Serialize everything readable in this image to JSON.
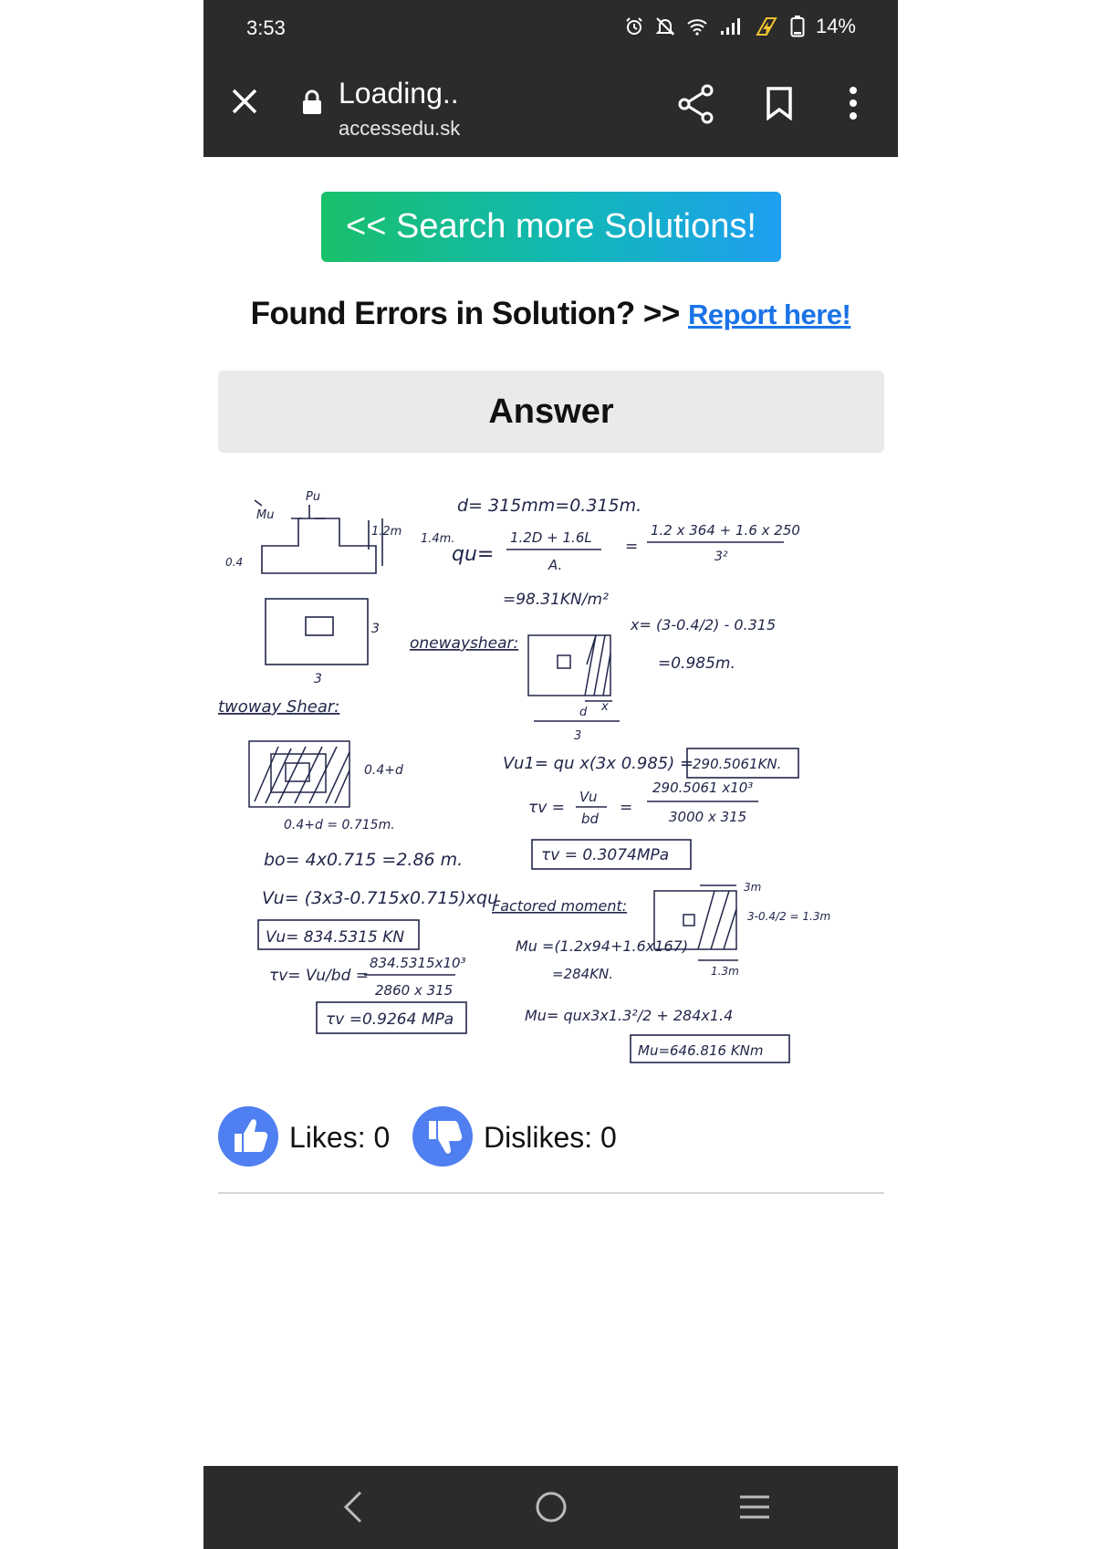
{
  "status_bar": {
    "time": "3:53",
    "battery": "14%",
    "icons": [
      "alarm-icon",
      "mute-icon",
      "wifi-icon",
      "signal-icon",
      "charging-icon",
      "battery-icon"
    ]
  },
  "browser": {
    "page_title": "Loading..",
    "domain": "accessedu.sk",
    "icons": [
      "close-icon",
      "lock-icon",
      "share-icon",
      "bookmark-icon",
      "more-vert-icon"
    ]
  },
  "page": {
    "search_button": "<< Search more Solutions!",
    "errors_text": "Found Errors in Solution? >>",
    "report_link": "Report here!",
    "answer_heading": "Answer"
  },
  "solution_sheet": {
    "labels": {
      "d_eq": "d= 315mm=0.315m.",
      "qu_label": "qu=",
      "qu_frac1_num": "1.2D + 1.6L",
      "qu_frac1_den": "A.",
      "qu_frac2_num": "1.2 x 364 + 1.6 x 250",
      "qu_frac2_den": "3²",
      "qu_result": "=98.31KN/m²",
      "one_way": "onewayshear:",
      "x_eq": "x= (3-0.4/2) - 0.315",
      "x_result": "=0.985m.",
      "vu1_eq": "Vu1= qu x(3x 0.985) =",
      "vu1_box": "290.5061KN.",
      "tv1_left": "τv =",
      "tv1_frac_num": "Vu",
      "tv1_frac_den": "bd",
      "tv1_eq": "=",
      "tv1_right_num": "290.5061 x10³",
      "tv1_right_den": "3000 x 315",
      "tv1_box": "τv = 0.3074MPa",
      "factored": "Factored moment:",
      "mu_eq": "Mu =(1.2x94+1.6x167)",
      "mu_result": "=284KN.",
      "mu2_eq": "Mu= qux3x1.3²/2 + 284x1.4",
      "mu_box": "Mu=646.816 KNm",
      "two_way": "twoway Shear:",
      "bo_eq": "bo= 4x0.715 =2.86 m.",
      "vu2_eq": "Vu= (3x3-0.715x0.715)xqu",
      "vu2_box": "Vu= 834.5315 KN",
      "tv2_left": "τv= Vu/bd =",
      "tv2_num": "834.5315x10³",
      "tv2_den": "2860 x 315",
      "tv2_box": "τv =0.9264 MPa",
      "dim_12": "1.2m",
      "dim_14": "1.4m.",
      "dim_04": "0.4",
      "dim_3": "3",
      "dim_0715": "0.4+d = 0.715m.",
      "dim_04d": "0.4+d",
      "pu": "Pu",
      "mu_top": "Mu",
      "dim_3m": "3m",
      "dim_13m": "1.3m",
      "frac_13": "3-0.4/2 = 1.3m",
      "d_lbl": "d",
      "x_lbl": "x"
    }
  },
  "reactions": {
    "likes": "Likes: 0",
    "dislikes": "Dislikes: 0"
  },
  "nav_bar": {
    "icons": [
      "back-icon",
      "home-icon",
      "recents-icon"
    ]
  }
}
